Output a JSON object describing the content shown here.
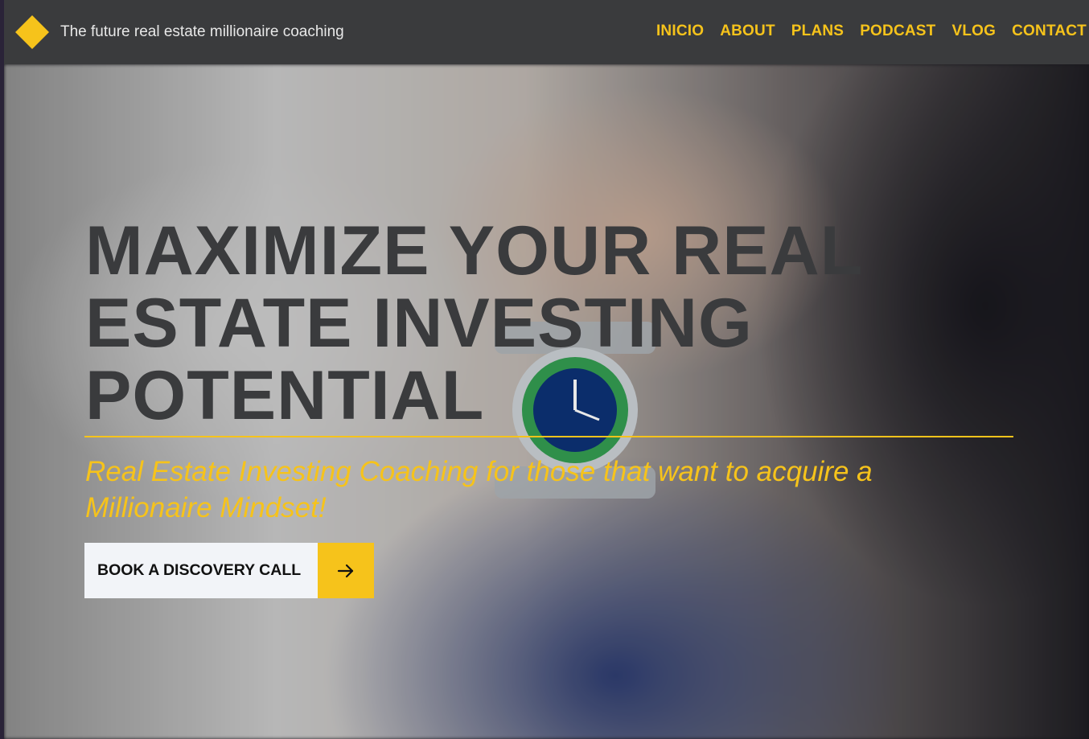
{
  "brand": {
    "logo_icon": "yellow-diamond-logo",
    "title": "The future real estate millionaire coaching"
  },
  "nav": {
    "items": [
      "INICIO",
      "ABOUT",
      "PLANS",
      "PODCAST",
      "VLOG",
      "CONTACT"
    ]
  },
  "hero": {
    "title": "MAXIMIZE YOUR REAL ESTATE INVESTING POTENTIAL",
    "subtitle": "Real Estate Investing Coaching for those that want to acquire a Millionaire Mindset!",
    "cta_label": "BOOK A DISCOVERY CALL",
    "cta_icon": "arrow-right-icon",
    "background_image": "man-checking-wristwatch-photo"
  },
  "colors": {
    "accent": "#f6c31b",
    "header_bg": "#3a3b3d",
    "title_text": "#3a3b3d",
    "cta_bg": "#f2f4f8"
  }
}
